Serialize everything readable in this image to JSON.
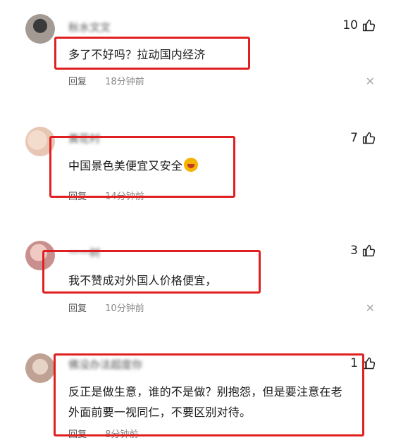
{
  "comments": [
    {
      "username": "秋水文文",
      "text": "多了不好吗？拉动国内经济",
      "reply": "回复",
      "time": "18分钟前",
      "likes": "10",
      "avatar_color": "#6d5f57"
    },
    {
      "username": "黄花村",
      "text": "中国景色美便宜又安全",
      "emoji": "crying-laughing-emoji",
      "reply": "回复",
      "time": "14分钟前",
      "likes": "7",
      "avatar_color": "#e8c8b2"
    },
    {
      "username": "一一树",
      "text": "我不赞成对外国人价格便宜，",
      "reply": "回复",
      "time": "10分钟前",
      "likes": "3",
      "avatar_color": "#d79a9a"
    },
    {
      "username": "佛没办法超度你",
      "text_line1": "反正是做生意，谁的不是做？别抱怨，但是要注意在老",
      "text_line2": "外面前要一视同仁，不要区别对待。",
      "reply": "回复",
      "time": "8分钟前",
      "likes": "1",
      "avatar_color": "#cdb4a4"
    }
  ],
  "highlight_color": "#e02020"
}
